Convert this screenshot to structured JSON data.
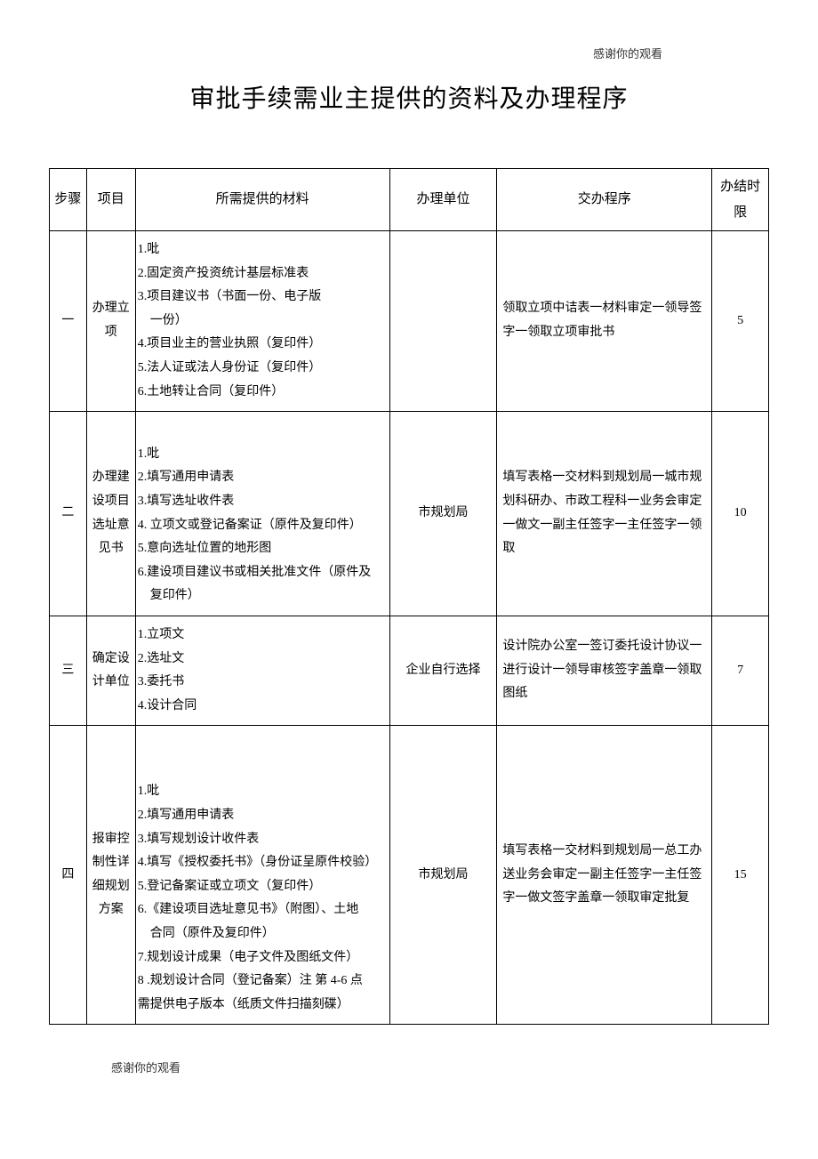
{
  "pageHeaderNote": "感谢你的观看",
  "title": "审批手续需业主提供的资料及办理程序",
  "headers": {
    "step": "步骤",
    "project": "项目",
    "materials": "所需提供的材料",
    "unit": "办理单位",
    "procedure": "交办程序",
    "deadline": "办结时限"
  },
  "rows": [
    {
      "step": "一",
      "project": "办理立项",
      "materialsLines": [
        "1.吡",
        "2.固定资产投资统计基层标准表",
        "3.项目建议书（书面一份、电子版",
        "　一份）",
        "4.项目业主的营业执照（复印件）",
        "5.法人证或法人身份证（复印件）",
        "6.土地转让合同（复印件）"
      ],
      "unit": "",
      "procedure": "领取立项中诘表一材料审定一领导签字一领取立项审批书",
      "deadline": "5"
    },
    {
      "step": "二",
      "project": "办理建设项目选址意见书",
      "materialsLines": [
        "",
        "1.吡",
        "2.填写通用申请表",
        "3.填写选址收件表",
        "4. 立项文或登记备案证（原件及复印件）",
        "5.意向选址位置的地形图",
        "6.建设项目建议书或相关批准文件（原件及",
        "　复印件）"
      ],
      "unit": "市规划局",
      "procedure": "填写表格一交材料到规划局一城市规划科研办、市政工程科一业务会审定一做文一副主任签字一主任签字一领取",
      "deadline": "10"
    },
    {
      "step": "三",
      "project": "确定设计单位",
      "materialsLines": [
        "1.立项文",
        "2.选址文",
        "3.委托书",
        "4.设计合同"
      ],
      "unit": "企业自行选择",
      "procedure": "设计院办公室一签订委托设计协议一进行设计一领导审核签字盖章一领取图纸",
      "deadline": "7"
    },
    {
      "step": "四",
      "project": "报审控制性详细规划方案",
      "materialsLines": [
        "",
        "",
        "1.吡",
        "2.填写通用申请表",
        "3.填写规划设计收件表",
        "4.填写《授权委托书》（身份证呈原件校验）",
        "5.登记备案证或立项文（复印件）",
        "6.《建设项目选址意见书》（附图）、土地",
        "　合同（原件及复印件）",
        "7.规划设计成果（电子文件及图纸文件）",
        "8 .规划设计合同（登记备案）注 第 4-6 点",
        "需提供电子版本（纸质文件扫描刻碟）"
      ],
      "unit": "市规划局",
      "procedure": "填写表格一交材料到规划局一总工办送业务会审定一副主任签字一主任签字一做文签字盖章一领取审定批复",
      "deadline": "15"
    }
  ],
  "pageFooterNote": "感谢你的观看"
}
